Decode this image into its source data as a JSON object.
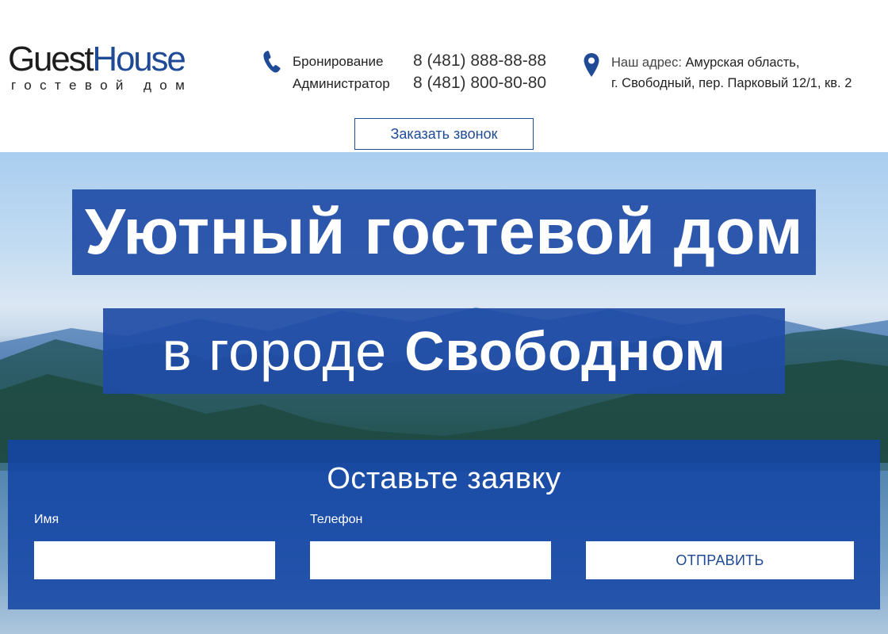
{
  "header": {
    "logo": {
      "word1": "Guest",
      "word2": "House",
      "subtitle": "гостевой дом"
    },
    "contacts": [
      {
        "label": "Бронирование",
        "number": "8 (481) 888-88-88"
      },
      {
        "label": "Администратор",
        "number": "8 (481) 800-80-80"
      }
    ],
    "address": {
      "label": "Наш адрес:",
      "line1": "Амурская область,",
      "line2": "г. Свободный, пер. Парковый 12/1, кв. 2"
    },
    "callback_label": "Заказать звонок"
  },
  "hero": {
    "headline1": "Уютный гостевой дом",
    "headline2_light": "в городе",
    "headline2_bold": "Свободном"
  },
  "form": {
    "title": "Оставьте заявку",
    "name_label": "Имя",
    "name_value": "",
    "phone_label": "Телефон",
    "phone_value": "",
    "submit_label": "ОТПРАВИТЬ"
  },
  "colors": {
    "brand_blue": "#1f4a96",
    "panel_blue": "#1f4ca6"
  },
  "icons": [
    "phone-icon",
    "map-pin-icon"
  ]
}
